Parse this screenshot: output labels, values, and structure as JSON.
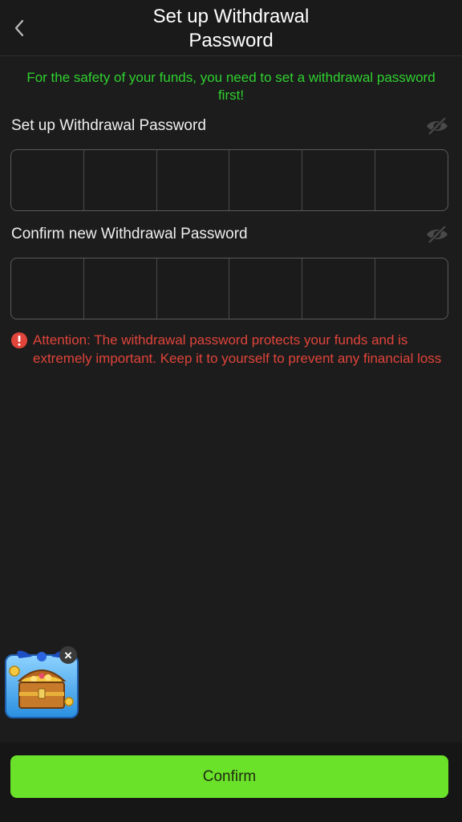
{
  "header": {
    "back_icon": "chevron-left-icon",
    "title": "Set up Withdrawal Password"
  },
  "notice": "For the safety of your funds, you need to set a withdrawal password first!",
  "fields": [
    {
      "label": "Set up Withdrawal Password",
      "visibility_icon": "eye-off-icon",
      "digits": 6
    },
    {
      "label": "Confirm new Withdrawal Password",
      "visibility_icon": "eye-off-icon",
      "digits": 6
    }
  ],
  "warning": {
    "icon": "exclamation-circle-icon",
    "text": "Attention: The withdrawal password protects your funds and is extremely important. Keep it to yourself to prevent any financial loss"
  },
  "promo": {
    "icon": "treasure-chest-icon",
    "close_icon": "close-icon"
  },
  "confirm_label": "Confirm",
  "colors": {
    "background": "#1c1c1c",
    "notice": "#2fd12f",
    "warning": "#e0443a",
    "confirm_button": "#6be22a"
  }
}
